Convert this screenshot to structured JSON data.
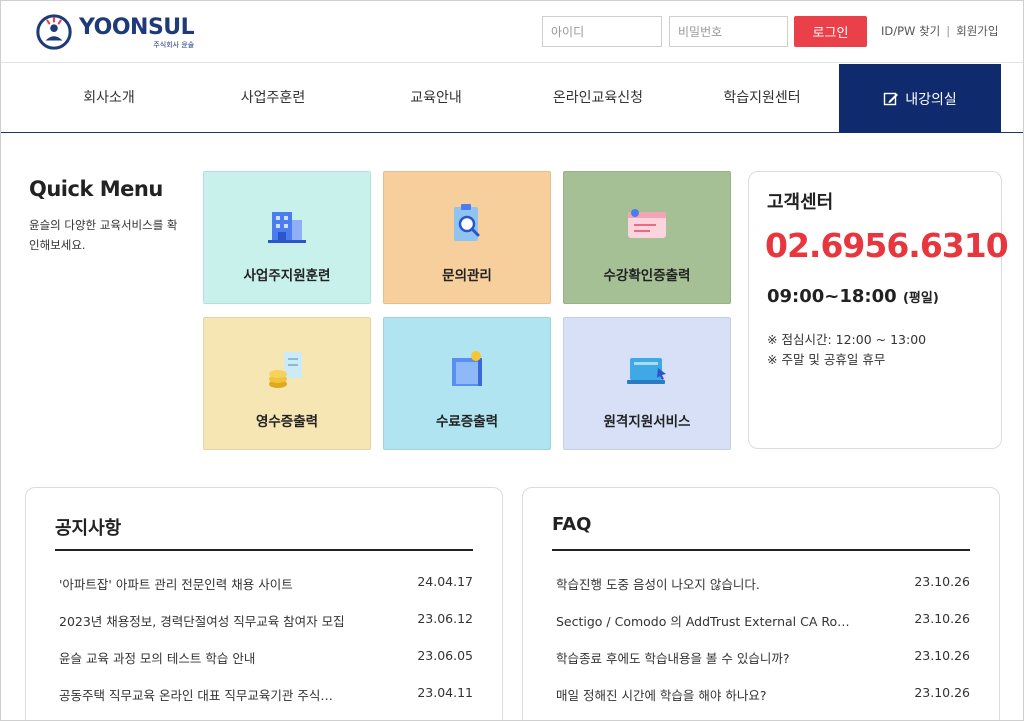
{
  "brand": {
    "name": "YOONSUL",
    "sub": "주식회사 윤술"
  },
  "login": {
    "id_placeholder": "아이디",
    "pw_placeholder": "비밀번호",
    "button": "로그인",
    "find_link": "ID/PW 찾기",
    "join_link": "회원가입"
  },
  "nav": {
    "items": [
      "회사소개",
      "사업주훈련",
      "교육안내",
      "온라인교육신청",
      "학습지원센터"
    ],
    "cta": "내강의실"
  },
  "quick_menu": {
    "title": "Quick Menu",
    "desc": "윤슬의 다양한 교육서비스를 확인해보세요.",
    "tiles": [
      {
        "label": "사업주지원훈련",
        "icon": "building-icon",
        "color": "#c9f1ec"
      },
      {
        "label": "문의관리",
        "icon": "clipboard-search-icon",
        "color": "#f7cf9c"
      },
      {
        "label": "수강확인증출력",
        "icon": "certificate-card-icon",
        "color": "#a6c095"
      },
      {
        "label": "영수증출력",
        "icon": "coins-receipt-icon",
        "color": "#f5e6b3"
      },
      {
        "label": "수료증출력",
        "icon": "diploma-scroll-icon",
        "color": "#b0e4f1"
      },
      {
        "label": "원격지원서비스",
        "icon": "remote-laptop-icon",
        "color": "#d7e0f6"
      }
    ]
  },
  "customer_center": {
    "title": "고객센터",
    "phone": "02.6956.6310",
    "hours": "09:00~18:00",
    "hours_note": "(평일)",
    "lunch": "※ 점심시간: 12:00 ~ 13:00",
    "holiday": "※ 주말 및 공휴일 휴무"
  },
  "notice": {
    "title": "공지사항",
    "items": [
      {
        "title": "'아파트잡' 아파트 관리 전문인력 채용 사이트",
        "date": "24.04.17"
      },
      {
        "title": "2023년 채용정보, 경력단절여성 직무교육 참여자 모집",
        "date": "23.06.12"
      },
      {
        "title": "윤슬 교육 과정 모의 테스트 학습 안내",
        "date": "23.06.05"
      },
      {
        "title": "공동주택 직무교육 온라인 대표 직무교육기관 주식…",
        "date": "23.04.11"
      }
    ]
  },
  "faq": {
    "title": "FAQ",
    "items": [
      {
        "title": "학습진행 도중 음성이 나오지 않습니다.",
        "date": "23.10.26"
      },
      {
        "title": "Sectigo / Comodo 의 AddTrust External CA Root …",
        "date": "23.10.26"
      },
      {
        "title": "학습종료 후에도 학습내용을 볼 수 있습니까?",
        "date": "23.10.26"
      },
      {
        "title": "매일 정해진 시간에 학습을 해야 하나요?",
        "date": "23.10.26"
      }
    ]
  }
}
